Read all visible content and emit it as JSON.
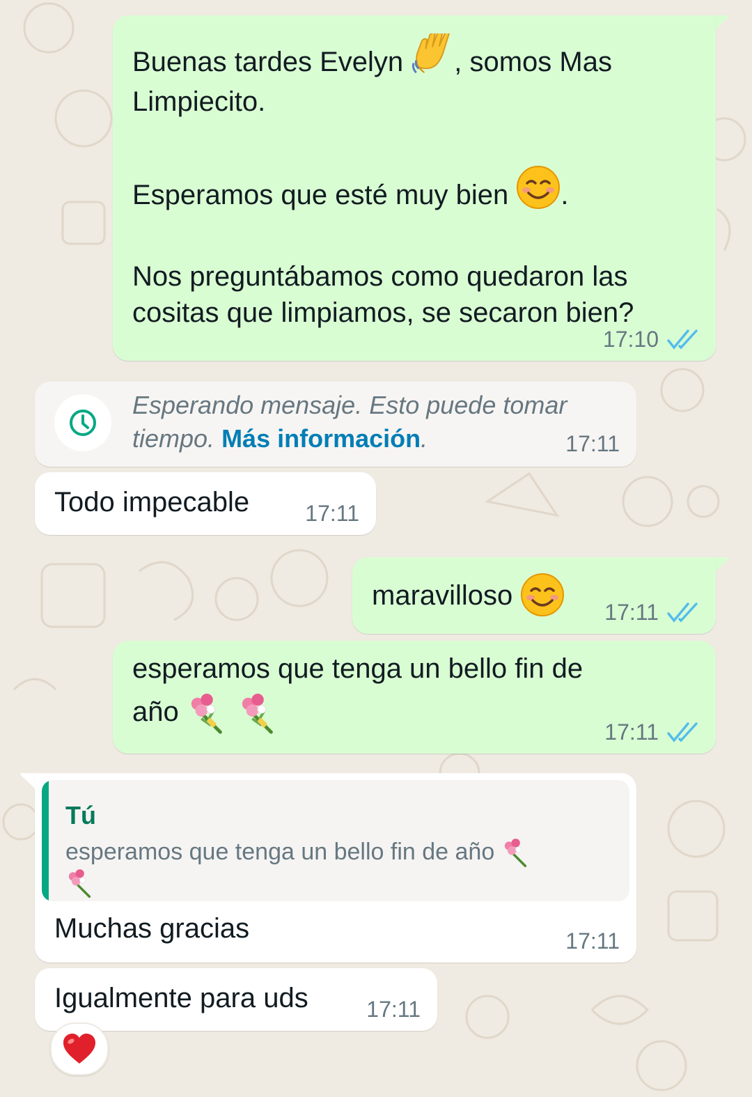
{
  "chat": {
    "messages": [
      {
        "direction": "outgoing",
        "lines": {
          "l1a": "Buenas tardes Evelyn ",
          "l1b": ", somos Mas",
          "l2": "Limpiecito.",
          "l3a": "Esperamos que esté muy bien ",
          "l3b": ".",
          "l4": "Nos preguntábamos como quedaron las",
          "l5": "cositas que limpiamos, se secaron bien?"
        },
        "time": "17:10",
        "status": "read"
      },
      {
        "direction": "incoming",
        "system": true,
        "text_italic": "Esperando mensaje. Esto puede tomar",
        "text_italic2": "tiempo. ",
        "link": "Más información",
        "link_suffix": ".",
        "time": "17:11",
        "icon": "clock-icon"
      },
      {
        "direction": "incoming",
        "text": "Todo impecable",
        "time": "17:11"
      },
      {
        "direction": "outgoing",
        "text": "maravilloso ",
        "time": "17:11",
        "status": "read"
      },
      {
        "direction": "outgoing",
        "line1": "esperamos que tenga un bello fin de",
        "line2": "año ",
        "time": "17:11",
        "status": "read"
      },
      {
        "direction": "incoming",
        "quote": {
          "author": "Tú",
          "text": "esperamos que tenga un bello fin de año "
        },
        "text": "Muchas gracias",
        "time": "17:11"
      },
      {
        "direction": "incoming",
        "text": "Igualmente para uds",
        "time": "17:11",
        "reaction": "heart"
      }
    ]
  },
  "colors": {
    "background": "#efeae2",
    "outgoing_bubble": "#d9fdd3",
    "incoming_bubble": "#ffffff",
    "read_ticks": "#53bdeb",
    "link": "#027eb5",
    "quote_bar": "#06a884",
    "quote_author": "#067a5c"
  }
}
